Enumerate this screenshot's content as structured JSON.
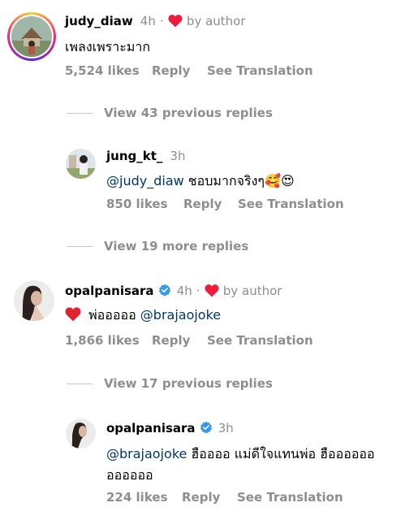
{
  "comments": [
    {
      "username": "judy_diaw",
      "time": "4h",
      "liked_by_author_text": "by author",
      "text": "เพลงเพราะมาก",
      "likes": "5,524 likes",
      "reply": "Reply",
      "translate": "See Translation"
    },
    {
      "username": "jung_kt_",
      "time": "3h",
      "mention": "@judy_diaw",
      "text": "ชอบมากจริงๆ",
      "emojis": "🥰😍",
      "likes": "850 likes",
      "reply": "Reply",
      "translate": "See Translation"
    },
    {
      "username": "opalpanisara",
      "time": "4h",
      "liked_by_author_text": "by author",
      "text": "พ่อออออ",
      "mention": "@brajaojoke",
      "likes": "1,866 likes",
      "reply": "Reply",
      "translate": "See Translation"
    },
    {
      "username": "opalpanisara",
      "time": "3h",
      "mention": "@brajaojoke",
      "text_line1": "ฮืออออ แม่ดีใจแทนพ่อ ฮืออออออ",
      "text_line2": "ออออออ",
      "likes": "224 likes",
      "reply": "Reply",
      "translate": "See Translation"
    }
  ],
  "view_replies": [
    "View 43 previous replies",
    "View 19 more replies",
    "View 17 previous replies"
  ],
  "colors": {
    "heart": "#ed1c3c",
    "verified": "#3797f0",
    "mention": "#00376b",
    "secondary_text": "#8e8e8e"
  },
  "icons": [
    "heart-icon",
    "verified-badge-icon",
    "red-heart-emoji",
    "smiling-face-with-hearts-emoji",
    "heart-eyes-emoji"
  ]
}
